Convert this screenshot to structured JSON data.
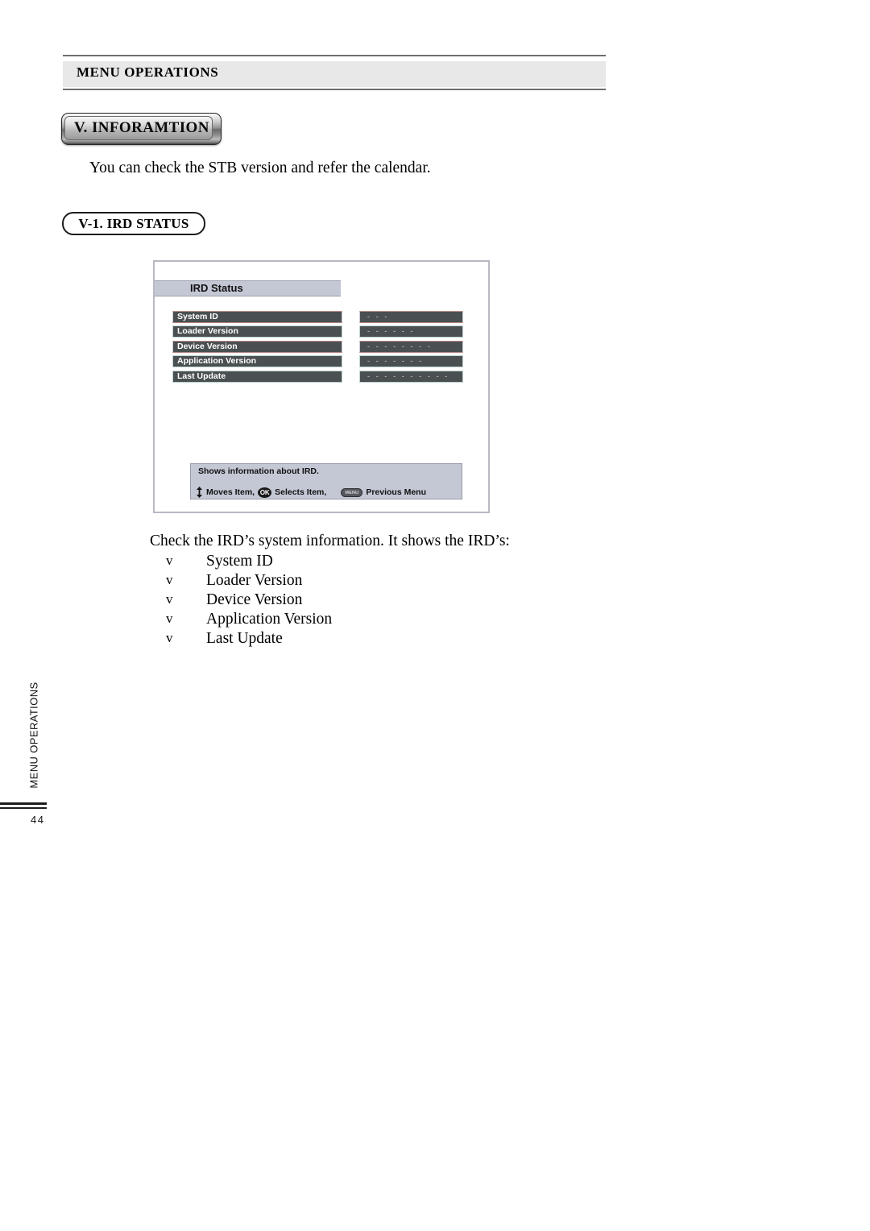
{
  "page": {
    "running_header": "MENU OPERATIONS",
    "side_label": "MENU OPERATIONS",
    "page_number": "44"
  },
  "section": {
    "button_label": "V. INFORAMTION",
    "intro_text": "You can check the STB version and refer the calendar.",
    "subsection_label": "V-1. IRD STATUS"
  },
  "osd": {
    "title": "IRD Status",
    "rows": [
      {
        "label": "System ID",
        "value": "- - -"
      },
      {
        "label": "Loader Version",
        "value": "- - - - - -"
      },
      {
        "label": "Device Version",
        "value": "- - - - - - - -"
      },
      {
        "label": "Application Version",
        "value": "- - - - - - -"
      },
      {
        "label": "Last Update",
        "value": "- - - - - - - - - -"
      }
    ],
    "help": {
      "description": "Shows information about IRD.",
      "moves_item": "Moves Item,",
      "ok_icon_label": "OK",
      "selects_item": "Selects Item,",
      "menu_icon_label": "MENU",
      "previous_menu": "Previous Menu"
    }
  },
  "body": {
    "lead": "Check the IRD’s system information. It shows the IRD’s:",
    "bullet_mark": "v",
    "items": [
      "System ID",
      "Loader Version",
      "Device Version",
      "Application Version",
      "Last Update"
    ]
  },
  "colors": {
    "header_band": "#e8e8e8",
    "osd_title_bg": "#c4c7d4",
    "osd_row_bg": "#4a5052",
    "osd_value_text": "#a9a2a2"
  }
}
